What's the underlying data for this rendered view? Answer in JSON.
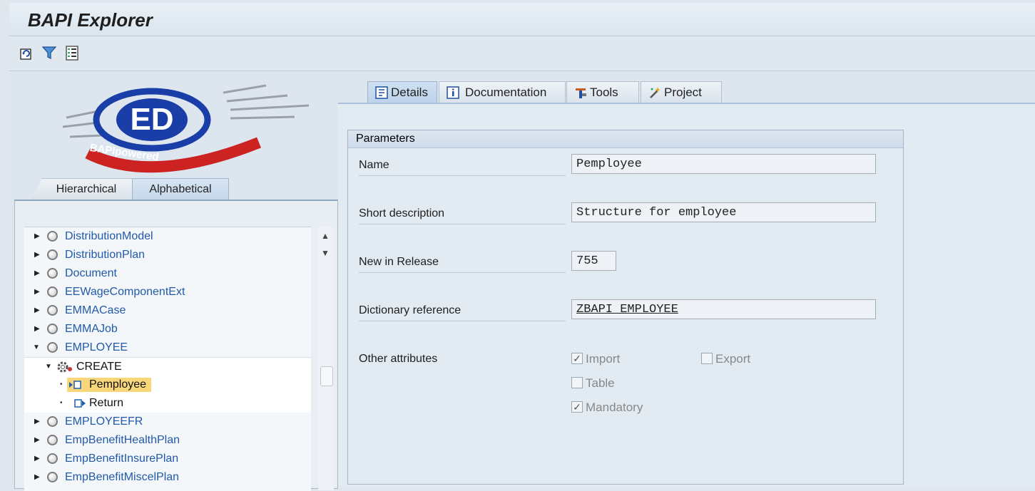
{
  "window": {
    "title": "BAPI Explorer"
  },
  "toolbar": {
    "buttons": [
      {
        "icon": "refresh-icon"
      },
      {
        "icon": "filter-icon"
      },
      {
        "icon": "list-settings-icon"
      }
    ]
  },
  "logo": {
    "text": "BAPIpowered"
  },
  "left_tabs": [
    {
      "label": "Hierarchical",
      "active": false
    },
    {
      "label": "Alphabetical",
      "active": true
    }
  ],
  "tree": {
    "items": [
      {
        "label": "DistributionModel",
        "level": 0,
        "expanded": false
      },
      {
        "label": "DistributionPlan",
        "level": 0,
        "expanded": false
      },
      {
        "label": "Document",
        "level": 0,
        "expanded": false
      },
      {
        "label": "EEWageComponentExt",
        "level": 0,
        "expanded": false
      },
      {
        "label": "EMMACase",
        "level": 0,
        "expanded": false
      },
      {
        "label": "EMMAJob",
        "level": 0,
        "expanded": false
      },
      {
        "label": "EMPLOYEE",
        "level": 0,
        "expanded": true
      },
      {
        "label": "CREATE",
        "level": 1,
        "expanded": true
      },
      {
        "label": "Pemployee",
        "level": 2,
        "selected": true
      },
      {
        "label": "Return",
        "level": 2
      },
      {
        "label": "EMPLOYEEFR",
        "level": 0,
        "expanded": false
      },
      {
        "label": "EmpBenefitHealthPlan",
        "level": 0,
        "expanded": false
      },
      {
        "label": "EmpBenefitInsurePlan",
        "level": 0,
        "expanded": false
      },
      {
        "label": "EmpBenefitMiscelPlan",
        "level": 0,
        "expanded": false
      }
    ]
  },
  "right_tabs": [
    {
      "label": "Details",
      "icon": "details-icon",
      "active": true
    },
    {
      "label": "Documentation",
      "icon": "info-icon"
    },
    {
      "label": "Tools",
      "icon": "tools-icon"
    },
    {
      "label": "Project",
      "icon": "magic-wand-icon"
    }
  ],
  "parameters": {
    "header": "Parameters",
    "name_label": "Name",
    "name_value": "Pemployee",
    "short_desc_label": "Short description",
    "short_desc_value": "Structure for employee",
    "release_label": "New in Release",
    "release_value": "755",
    "dict_ref_label": "Dictionary reference",
    "dict_ref_value": "ZBAPI_EMPLOYEE",
    "other_label": "Other attributes",
    "import_label": "Import",
    "import_checked": true,
    "export_label": "Export",
    "export_checked": false,
    "table_label": "Table",
    "table_checked": false,
    "mandatory_label": "Mandatory",
    "mandatory_checked": true
  },
  "colors": {
    "link": "#2259a8",
    "selected_bg": "#f7d77a",
    "title_bg": "#e9f0f6"
  }
}
